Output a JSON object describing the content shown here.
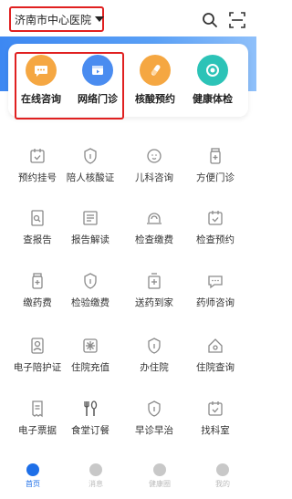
{
  "header": {
    "hospital_name": "济南市中心医院"
  },
  "quick": [
    {
      "label": "在线咨询",
      "color": "#f5a742",
      "icon": "chat-bubble-icon"
    },
    {
      "label": "网络门诊",
      "color": "#4a8cf0",
      "icon": "video-clinic-icon"
    },
    {
      "label": "核酸预约",
      "color": "#f5a742",
      "icon": "test-tube-icon"
    },
    {
      "label": "健康体检",
      "color": "#2cc3b7",
      "icon": "checkup-icon"
    }
  ],
  "grid": [
    {
      "label": "预约挂号",
      "icon": "calendar-check-icon"
    },
    {
      "label": "陪人核酸证",
      "icon": "shield-icon"
    },
    {
      "label": "儿科咨询",
      "icon": "baby-face-icon"
    },
    {
      "label": "方便门诊",
      "icon": "medicine-bottle-icon"
    },
    {
      "label": "查报告",
      "icon": "report-search-icon"
    },
    {
      "label": "报告解读",
      "icon": "report-read-icon"
    },
    {
      "label": "检查缴费",
      "icon": "dome-icon"
    },
    {
      "label": "检查预约",
      "icon": "calendar-check-icon"
    },
    {
      "label": "缴药费",
      "icon": "medicine-bottle-icon"
    },
    {
      "label": "检验缴费",
      "icon": "shield-icon"
    },
    {
      "label": "送药到家",
      "icon": "medicine-box-icon"
    },
    {
      "label": "药师咨询",
      "icon": "chat-icon"
    },
    {
      "label": "电子陪护证",
      "icon": "id-card-icon"
    },
    {
      "label": "住院充值",
      "icon": "sparkle-coin-icon"
    },
    {
      "label": "办住院",
      "icon": "shield-icon"
    },
    {
      "label": "住院查询",
      "icon": "house-search-icon"
    },
    {
      "label": "电子票据",
      "icon": "receipt-icon"
    },
    {
      "label": "食堂订餐",
      "icon": "fork-spoon-icon"
    },
    {
      "label": "早诊早治",
      "icon": "shield-icon"
    },
    {
      "label": "找科室",
      "icon": "calendar-check-icon"
    }
  ],
  "nav": [
    {
      "label": "首页",
      "color": "#1e6fe8",
      "active": true
    },
    {
      "label": "消息",
      "color": "#c8c8c8",
      "active": false
    },
    {
      "label": "健康圈",
      "color": "#c8c8c8",
      "active": false
    },
    {
      "label": "我的",
      "color": "#c8c8c8",
      "active": false
    }
  ],
  "colors": {
    "accent": "#1e6fe8",
    "highlight": "#e02020",
    "icon_gray": "#8a8a8a"
  }
}
